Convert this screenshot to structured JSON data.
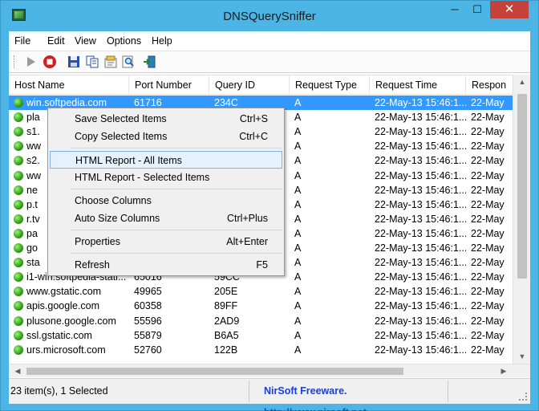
{
  "window": {
    "title": "DNSQuerySniffer"
  },
  "window_buttons": {
    "minimize": "─",
    "maximize": "☐",
    "close": "✕"
  },
  "menu": [
    "File",
    "Edit",
    "View",
    "Options",
    "Help"
  ],
  "columns": [
    "Host Name",
    "Port Number",
    "Query ID",
    "Request Type",
    "Request Time",
    "Respon"
  ],
  "rows": [
    {
      "host": "win.softpedia.com",
      "port": "61716",
      "qid": "234C",
      "type": "A",
      "time": "22-May-13 15:46:1...",
      "resp": "22-May",
      "selected": true
    },
    {
      "host": "pla",
      "port": "",
      "qid": "",
      "type": "A",
      "time": "22-May-13 15:46:1...",
      "resp": "22-May",
      "selected": false
    },
    {
      "host": "s1.",
      "port": "",
      "qid": "",
      "type": "A",
      "time": "22-May-13 15:46:1...",
      "resp": "22-May",
      "selected": false
    },
    {
      "host": "ww",
      "port": "",
      "qid": "",
      "type": "A",
      "time": "22-May-13 15:46:1...",
      "resp": "22-May",
      "selected": false
    },
    {
      "host": "s2.",
      "port": "",
      "qid": "",
      "type": "A",
      "time": "22-May-13 15:46:1...",
      "resp": "22-May",
      "selected": false
    },
    {
      "host": "ww",
      "port": "",
      "qid": "",
      "type": "A",
      "time": "22-May-13 15:46:1...",
      "resp": "22-May",
      "selected": false
    },
    {
      "host": "ne",
      "port": "",
      "qid": "",
      "type": "A",
      "time": "22-May-13 15:46:1...",
      "resp": "22-May",
      "selected": false
    },
    {
      "host": "p.t",
      "port": "",
      "qid": "",
      "type": "A",
      "time": "22-May-13 15:46:1...",
      "resp": "22-May",
      "selected": false
    },
    {
      "host": "r.tv",
      "port": "",
      "qid": "",
      "type": "A",
      "time": "22-May-13 15:46:1...",
      "resp": "22-May",
      "selected": false
    },
    {
      "host": "pa",
      "port": "",
      "qid": "",
      "type": "A",
      "time": "22-May-13 15:46:1...",
      "resp": "22-May",
      "selected": false
    },
    {
      "host": "go",
      "port": "",
      "qid": "",
      "type": "A",
      "time": "22-May-13 15:46:1...",
      "resp": "22-May",
      "selected": false
    },
    {
      "host": "sta",
      "port": "",
      "qid": "",
      "type": "A",
      "time": "22-May-13 15:46:1...",
      "resp": "22-May",
      "selected": false
    },
    {
      "host": "i1-win.softpedia-stati...",
      "port": "65016",
      "qid": "59CC",
      "type": "A",
      "time": "22-May-13 15:46:1...",
      "resp": "22-May",
      "selected": false
    },
    {
      "host": "www.gstatic.com",
      "port": "49965",
      "qid": "205E",
      "type": "A",
      "time": "22-May-13 15:46:1...",
      "resp": "22-May",
      "selected": false
    },
    {
      "host": "apis.google.com",
      "port": "60358",
      "qid": "89FF",
      "type": "A",
      "time": "22-May-13 15:46:1...",
      "resp": "22-May",
      "selected": false
    },
    {
      "host": "plusone.google.com",
      "port": "55596",
      "qid": "2AD9",
      "type": "A",
      "time": "22-May-13 15:46:1...",
      "resp": "22-May",
      "selected": false
    },
    {
      "host": "ssl.gstatic.com",
      "port": "55879",
      "qid": "B6A5",
      "type": "A",
      "time": "22-May-13 15:46:1...",
      "resp": "22-May",
      "selected": false
    },
    {
      "host": "urs.microsoft.com",
      "port": "52760",
      "qid": "122B",
      "type": "A",
      "time": "22-May-13 15:46:1...",
      "resp": "22-May",
      "selected": false
    }
  ],
  "context_menu": [
    {
      "label": "Save Selected Items",
      "shortcut": "Ctrl+S"
    },
    {
      "label": "Copy Selected Items",
      "shortcut": "Ctrl+C"
    },
    {
      "label": "HTML Report - All Items",
      "shortcut": ""
    },
    {
      "label": "HTML Report - Selected Items",
      "shortcut": ""
    },
    {
      "label": "Choose Columns",
      "shortcut": ""
    },
    {
      "label": "Auto Size Columns",
      "shortcut": "Ctrl+Plus"
    },
    {
      "label": "Properties",
      "shortcut": "Alt+Enter"
    },
    {
      "label": "Refresh",
      "shortcut": "F5"
    }
  ],
  "status": {
    "count": "23 item(s), 1 Selected",
    "credit": "NirSoft Freeware.  http://www.nirsoft.net"
  },
  "colors": {
    "titlebar": "#4bb5e6",
    "selection": "#3399ff",
    "status_link": "#1a3fd1",
    "close": "#c7413b"
  }
}
